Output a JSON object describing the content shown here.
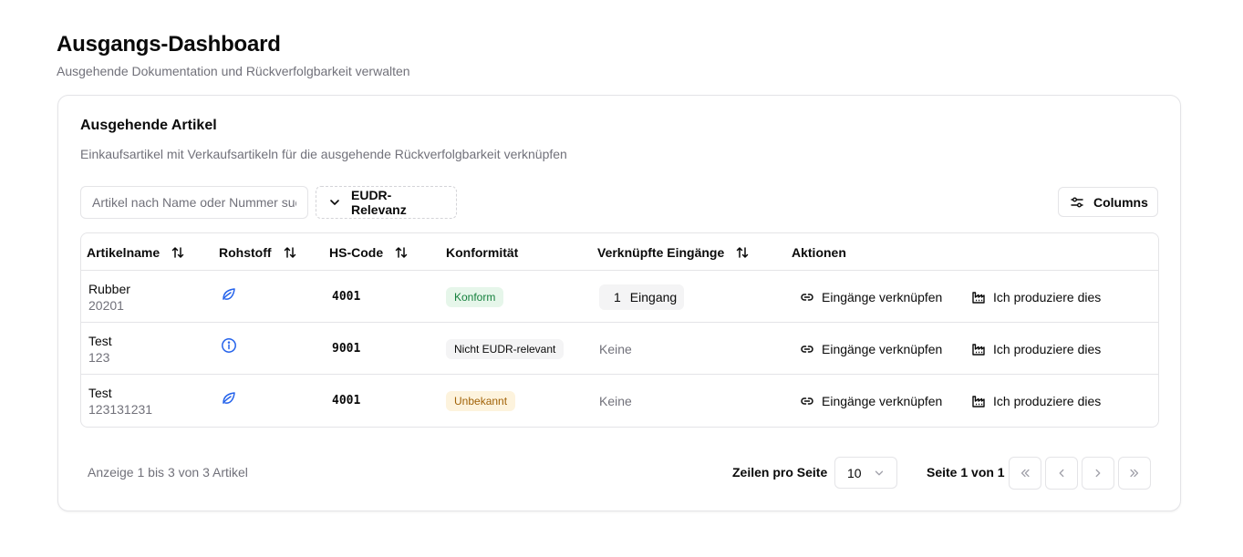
{
  "header": {
    "title": "Ausgangs-Dashboard",
    "subtitle": "Ausgehende Dokumentation und Rückverfolgbarkeit verwalten"
  },
  "card": {
    "title": "Ausgehende Artikel",
    "description": "Einkaufsartikel mit Verkaufsartikeln für die ausgehende Rückverfolgbarkeit verknüpfen"
  },
  "toolbar": {
    "search_placeholder": "Artikel nach Name oder Nummer suchen...",
    "filter_label": "EUDR-Relevanz",
    "columns_label": "Columns"
  },
  "table": {
    "columns": [
      "Artikelname",
      "Rohstoff",
      "HS-Code",
      "Konformität",
      "Verknüpfte Eingänge",
      "Aktionen"
    ],
    "rows": [
      {
        "name": "Rubber",
        "number": "20201",
        "commodity_icon": "leaf-icon",
        "hs_code": "4001",
        "conformity": "Konform",
        "conformity_status": "green",
        "linked_count": "1",
        "linked_label": "Eingang",
        "action_link": "Eingänge verknüpfen",
        "action_produce": "Ich produziere dies"
      },
      {
        "name": "Test",
        "number": "123",
        "commodity_icon": "info-icon",
        "hs_code": "9001",
        "conformity": "Nicht EUDR-relevant",
        "conformity_status": "gray",
        "linked_none": "Keine",
        "action_link": "Eingänge verknüpfen",
        "action_produce": "Ich produziere dies"
      },
      {
        "name": "Test",
        "number": "123131231",
        "commodity_icon": "leaf-icon",
        "hs_code": "4001",
        "conformity": "Unbekannt",
        "conformity_status": "amber",
        "linked_none": "Keine",
        "action_link": "Eingänge verknüpfen",
        "action_produce": "Ich produziere dies"
      }
    ]
  },
  "footer": {
    "info": "Anzeige 1 bis 3 von 3 Artikel",
    "rows_per_page_label": "Zeilen pro Seite",
    "rows_per_page_value": "10",
    "page_label": "Seite 1 von 1"
  },
  "colors": {
    "accent_icon": "#2563eb",
    "badge_green": "#15803d",
    "badge_amber": "#a16207"
  }
}
